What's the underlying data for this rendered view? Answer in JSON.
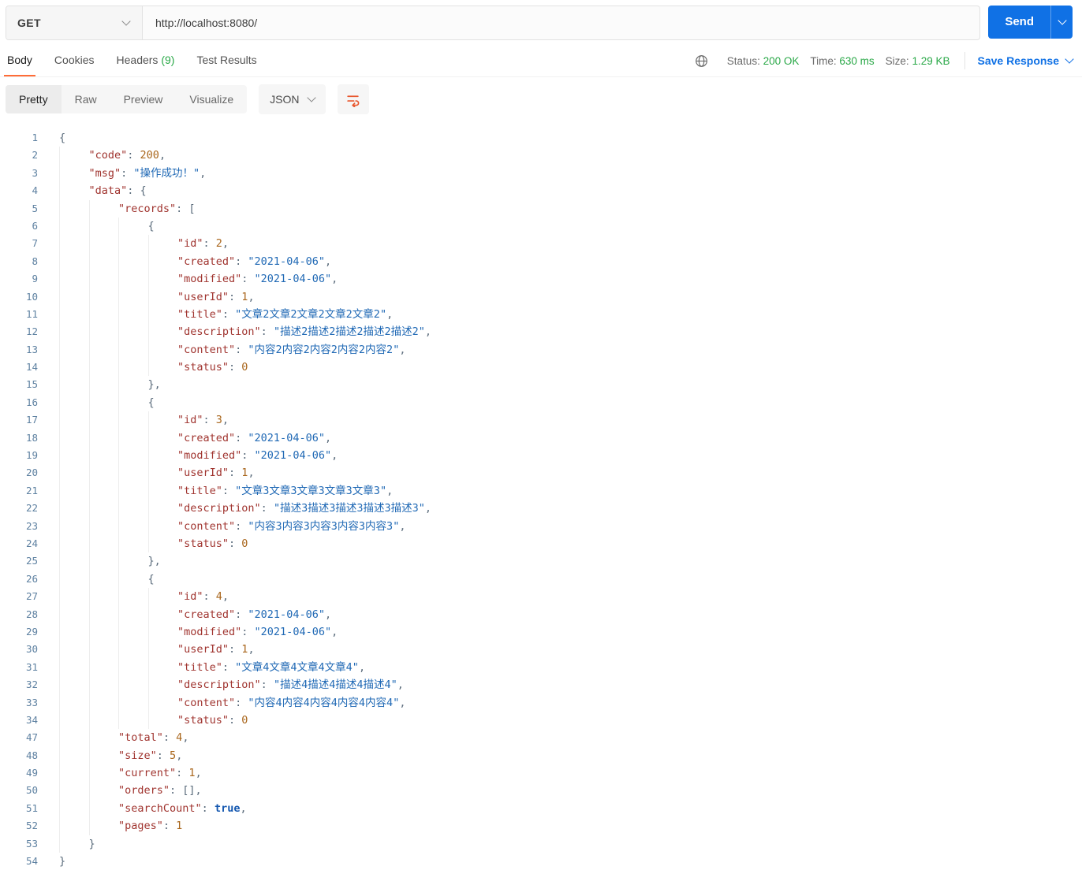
{
  "request_bar": {
    "method": "GET",
    "url": "http://localhost:8080/",
    "send_label": "Send"
  },
  "response_tabs": {
    "items": [
      {
        "label": "Body",
        "active": true
      },
      {
        "label": "Cookies",
        "active": false
      },
      {
        "label": "Headers",
        "badge": "(9)",
        "active": false
      },
      {
        "label": "Test Results",
        "active": false
      }
    ]
  },
  "response_meta": {
    "status_label": "Status:",
    "status_value": "200 OK",
    "time_label": "Time:",
    "time_value": "630 ms",
    "size_label": "Size:",
    "size_value": "1.29 KB",
    "save_label": "Save Response"
  },
  "view_bar": {
    "tabs": [
      {
        "label": "Pretty",
        "active": true
      },
      {
        "label": "Raw",
        "active": false
      },
      {
        "label": "Preview",
        "active": false
      },
      {
        "label": "Visualize",
        "active": false
      }
    ],
    "format": "JSON"
  },
  "icons": {
    "globe": "globe-icon",
    "wrap": "wrap-text-icon",
    "chevron": "chevron-down-icon"
  },
  "colors": {
    "accent_orange": "#FF6C37",
    "send_blue": "#1071E5",
    "status_green": "#29A847",
    "token_key": "#A0342F",
    "token_string": "#2069B5",
    "token_number": "#A9661C",
    "token_boolean": "#1558B0",
    "line_number": "#5E81A1"
  },
  "code": {
    "language": "JSON",
    "lines": [
      {
        "n": 1,
        "i": 0,
        "t": [
          [
            "p",
            "{"
          ]
        ]
      },
      {
        "n": 2,
        "i": 1,
        "t": [
          [
            "k",
            "\"code\""
          ],
          [
            "p",
            ": "
          ],
          [
            "n",
            "200"
          ],
          [
            "p",
            ","
          ]
        ]
      },
      {
        "n": 3,
        "i": 1,
        "t": [
          [
            "k",
            "\"msg\""
          ],
          [
            "p",
            ": "
          ],
          [
            "s",
            "\"操作成功！\""
          ],
          [
            "p",
            ","
          ]
        ]
      },
      {
        "n": 4,
        "i": 1,
        "t": [
          [
            "k",
            "\"data\""
          ],
          [
            "p",
            ": "
          ],
          [
            "p",
            "{"
          ]
        ]
      },
      {
        "n": 5,
        "i": 2,
        "t": [
          [
            "k",
            "\"records\""
          ],
          [
            "p",
            ": "
          ],
          [
            "p",
            "["
          ]
        ]
      },
      {
        "n": 6,
        "i": 3,
        "t": [
          [
            "p",
            "{"
          ]
        ]
      },
      {
        "n": 7,
        "i": 4,
        "t": [
          [
            "k",
            "\"id\""
          ],
          [
            "p",
            ": "
          ],
          [
            "n",
            "2"
          ],
          [
            "p",
            ","
          ]
        ]
      },
      {
        "n": 8,
        "i": 4,
        "t": [
          [
            "k",
            "\"created\""
          ],
          [
            "p",
            ": "
          ],
          [
            "s",
            "\"2021-04-06\""
          ],
          [
            "p",
            ","
          ]
        ]
      },
      {
        "n": 9,
        "i": 4,
        "t": [
          [
            "k",
            "\"modified\""
          ],
          [
            "p",
            ": "
          ],
          [
            "s",
            "\"2021-04-06\""
          ],
          [
            "p",
            ","
          ]
        ]
      },
      {
        "n": 10,
        "i": 4,
        "t": [
          [
            "k",
            "\"userId\""
          ],
          [
            "p",
            ": "
          ],
          [
            "n",
            "1"
          ],
          [
            "p",
            ","
          ]
        ]
      },
      {
        "n": 11,
        "i": 4,
        "t": [
          [
            "k",
            "\"title\""
          ],
          [
            "p",
            ": "
          ],
          [
            "s",
            "\"文章2文章2文章2文章2文章2\""
          ],
          [
            "p",
            ","
          ]
        ]
      },
      {
        "n": 12,
        "i": 4,
        "t": [
          [
            "k",
            "\"description\""
          ],
          [
            "p",
            ": "
          ],
          [
            "s",
            "\"描述2描述2描述2描述2描述2\""
          ],
          [
            "p",
            ","
          ]
        ]
      },
      {
        "n": 13,
        "i": 4,
        "t": [
          [
            "k",
            "\"content\""
          ],
          [
            "p",
            ": "
          ],
          [
            "s",
            "\"内容2内容2内容2内容2内容2\""
          ],
          [
            "p",
            ","
          ]
        ]
      },
      {
        "n": 14,
        "i": 4,
        "t": [
          [
            "k",
            "\"status\""
          ],
          [
            "p",
            ": "
          ],
          [
            "n",
            "0"
          ]
        ]
      },
      {
        "n": 15,
        "i": 3,
        "t": [
          [
            "p",
            "},"
          ]
        ]
      },
      {
        "n": 16,
        "i": 3,
        "t": [
          [
            "p",
            "{"
          ]
        ]
      },
      {
        "n": 17,
        "i": 4,
        "t": [
          [
            "k",
            "\"id\""
          ],
          [
            "p",
            ": "
          ],
          [
            "n",
            "3"
          ],
          [
            "p",
            ","
          ]
        ]
      },
      {
        "n": 18,
        "i": 4,
        "t": [
          [
            "k",
            "\"created\""
          ],
          [
            "p",
            ": "
          ],
          [
            "s",
            "\"2021-04-06\""
          ],
          [
            "p",
            ","
          ]
        ]
      },
      {
        "n": 19,
        "i": 4,
        "t": [
          [
            "k",
            "\"modified\""
          ],
          [
            "p",
            ": "
          ],
          [
            "s",
            "\"2021-04-06\""
          ],
          [
            "p",
            ","
          ]
        ]
      },
      {
        "n": 20,
        "i": 4,
        "t": [
          [
            "k",
            "\"userId\""
          ],
          [
            "p",
            ": "
          ],
          [
            "n",
            "1"
          ],
          [
            "p",
            ","
          ]
        ]
      },
      {
        "n": 21,
        "i": 4,
        "t": [
          [
            "k",
            "\"title\""
          ],
          [
            "p",
            ": "
          ],
          [
            "s",
            "\"文章3文章3文章3文章3文章3\""
          ],
          [
            "p",
            ","
          ]
        ]
      },
      {
        "n": 22,
        "i": 4,
        "t": [
          [
            "k",
            "\"description\""
          ],
          [
            "p",
            ": "
          ],
          [
            "s",
            "\"描述3描述3描述3描述3描述3\""
          ],
          [
            "p",
            ","
          ]
        ]
      },
      {
        "n": 23,
        "i": 4,
        "t": [
          [
            "k",
            "\"content\""
          ],
          [
            "p",
            ": "
          ],
          [
            "s",
            "\"内容3内容3内容3内容3内容3\""
          ],
          [
            "p",
            ","
          ]
        ]
      },
      {
        "n": 24,
        "i": 4,
        "t": [
          [
            "k",
            "\"status\""
          ],
          [
            "p",
            ": "
          ],
          [
            "n",
            "0"
          ]
        ]
      },
      {
        "n": 25,
        "i": 3,
        "t": [
          [
            "p",
            "},"
          ]
        ]
      },
      {
        "n": 26,
        "i": 3,
        "t": [
          [
            "p",
            "{"
          ]
        ]
      },
      {
        "n": 27,
        "i": 4,
        "t": [
          [
            "k",
            "\"id\""
          ],
          [
            "p",
            ": "
          ],
          [
            "n",
            "4"
          ],
          [
            "p",
            ","
          ]
        ]
      },
      {
        "n": 28,
        "i": 4,
        "t": [
          [
            "k",
            "\"created\""
          ],
          [
            "p",
            ": "
          ],
          [
            "s",
            "\"2021-04-06\""
          ],
          [
            "p",
            ","
          ]
        ]
      },
      {
        "n": 29,
        "i": 4,
        "t": [
          [
            "k",
            "\"modified\""
          ],
          [
            "p",
            ": "
          ],
          [
            "s",
            "\"2021-04-06\""
          ],
          [
            "p",
            ","
          ]
        ]
      },
      {
        "n": 30,
        "i": 4,
        "t": [
          [
            "k",
            "\"userId\""
          ],
          [
            "p",
            ": "
          ],
          [
            "n",
            "1"
          ],
          [
            "p",
            ","
          ]
        ]
      },
      {
        "n": 31,
        "i": 4,
        "t": [
          [
            "k",
            "\"title\""
          ],
          [
            "p",
            ": "
          ],
          [
            "s",
            "\"文章4文章4文章4文章4\""
          ],
          [
            "p",
            ","
          ]
        ]
      },
      {
        "n": 32,
        "i": 4,
        "t": [
          [
            "k",
            "\"description\""
          ],
          [
            "p",
            ": "
          ],
          [
            "s",
            "\"描述4描述4描述4描述4\""
          ],
          [
            "p",
            ","
          ]
        ]
      },
      {
        "n": 33,
        "i": 4,
        "t": [
          [
            "k",
            "\"content\""
          ],
          [
            "p",
            ": "
          ],
          [
            "s",
            "\"内容4内容4内容4内容4内容4\""
          ],
          [
            "p",
            ","
          ]
        ]
      },
      {
        "n": 34,
        "i": 4,
        "t": [
          [
            "k",
            "\"status\""
          ],
          [
            "p",
            ": "
          ],
          [
            "n",
            "0"
          ]
        ]
      },
      {
        "n": 47,
        "i": 2,
        "t": [
          [
            "k",
            "\"total\""
          ],
          [
            "p",
            ": "
          ],
          [
            "n",
            "4"
          ],
          [
            "p",
            ","
          ]
        ]
      },
      {
        "n": 48,
        "i": 2,
        "t": [
          [
            "k",
            "\"size\""
          ],
          [
            "p",
            ": "
          ],
          [
            "n",
            "5"
          ],
          [
            "p",
            ","
          ]
        ]
      },
      {
        "n": 49,
        "i": 2,
        "t": [
          [
            "k",
            "\"current\""
          ],
          [
            "p",
            ": "
          ],
          [
            "n",
            "1"
          ],
          [
            "p",
            ","
          ]
        ]
      },
      {
        "n": 50,
        "i": 2,
        "t": [
          [
            "k",
            "\"orders\""
          ],
          [
            "p",
            ": "
          ],
          [
            "p",
            "[],"
          ]
        ]
      },
      {
        "n": 51,
        "i": 2,
        "t": [
          [
            "k",
            "\"searchCount\""
          ],
          [
            "p",
            ": "
          ],
          [
            "b",
            "true"
          ],
          [
            "p",
            ","
          ]
        ]
      },
      {
        "n": 52,
        "i": 2,
        "t": [
          [
            "k",
            "\"pages\""
          ],
          [
            "p",
            ": "
          ],
          [
            "n",
            "1"
          ]
        ]
      },
      {
        "n": 53,
        "i": 1,
        "t": [
          [
            "p",
            "}"
          ]
        ]
      },
      {
        "n": 54,
        "i": 0,
        "t": [
          [
            "p",
            "}"
          ]
        ]
      }
    ]
  }
}
